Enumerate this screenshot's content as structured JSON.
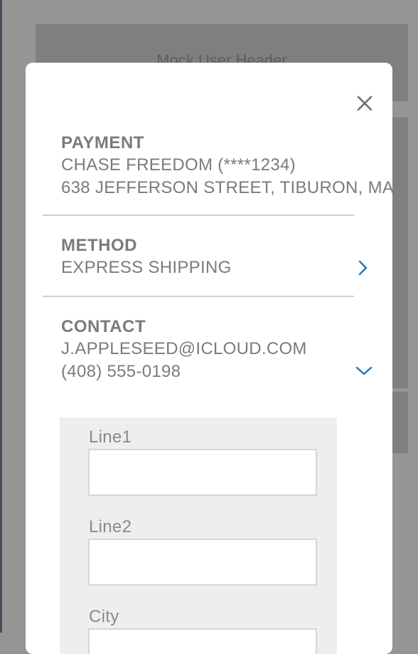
{
  "background": {
    "header_label": "Mock User Header"
  },
  "close_icon": "close-icon",
  "sections": {
    "payment": {
      "title": "PAYMENT",
      "line1": "CHASE FREEDOM (****1234)",
      "line2": "638 JEFFERSON STREET, TIBURON, MA"
    },
    "method": {
      "title": "METHOD",
      "line1": "EXPRESS SHIPPING",
      "icon": "chevron-right-icon"
    },
    "contact": {
      "title": "CONTACT",
      "line1": "J.APPLESEED@ICLOUD.COM",
      "line2": "(408) 555-0198",
      "icon": "chevron-down-icon"
    }
  },
  "form": {
    "line1_label": "Line1",
    "line1_value": "",
    "line2_label": "Line2",
    "line2_value": "",
    "city_label": "City",
    "city_value": ""
  },
  "colors": {
    "accent": "#1a78c2",
    "overlay": "#959595",
    "text": "#7b7b7b"
  }
}
